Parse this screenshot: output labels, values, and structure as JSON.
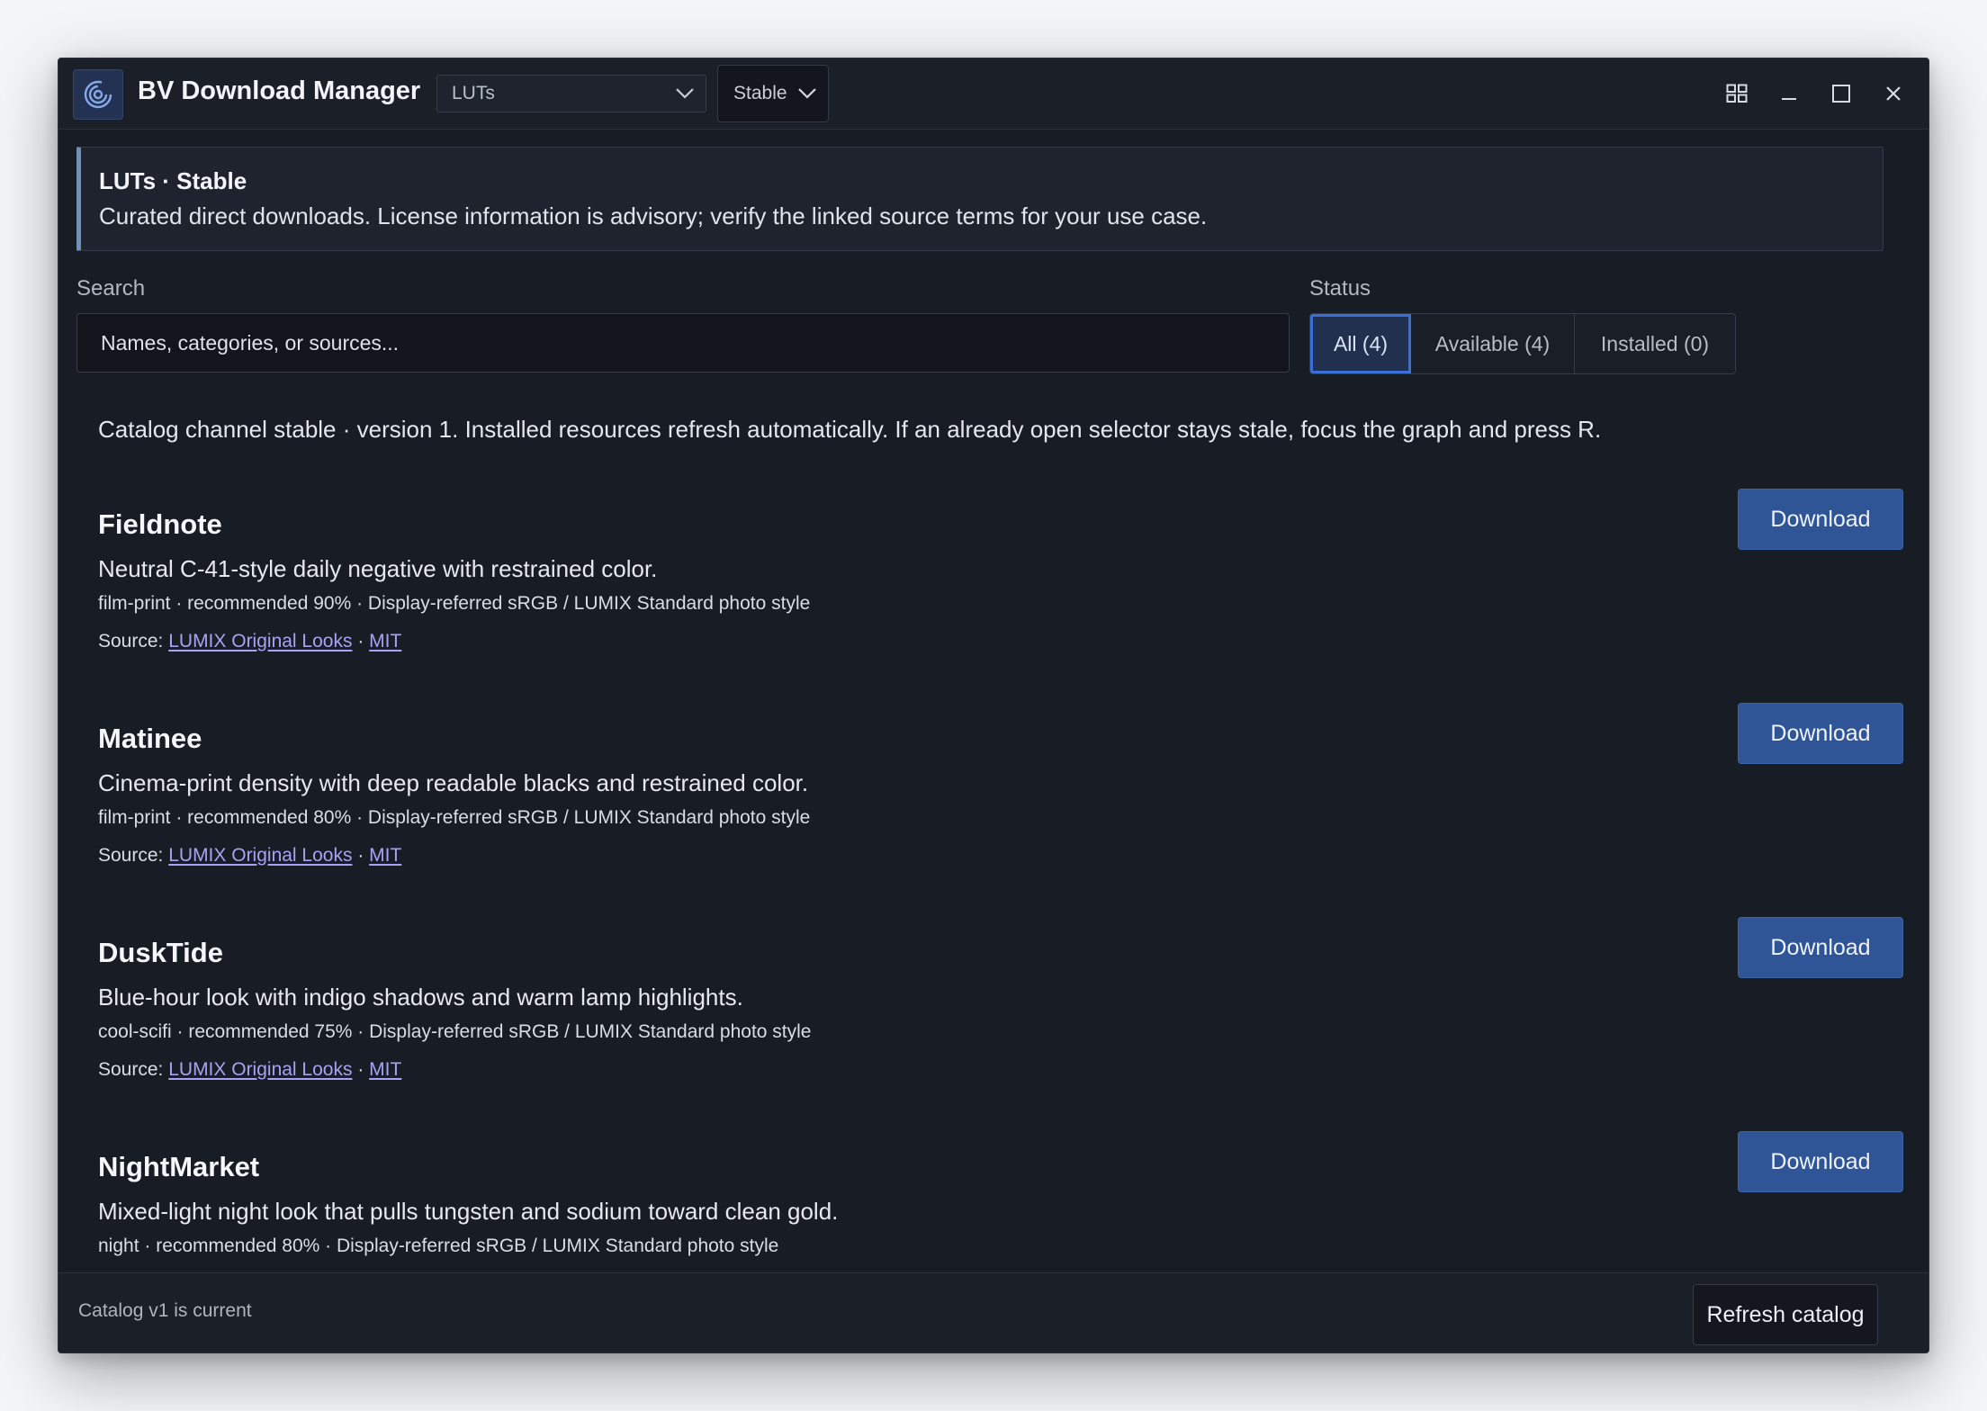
{
  "app": {
    "title": "BV Download Manager",
    "icon": "swirl-icon",
    "accent_color": "#3b6fd8"
  },
  "header": {
    "category_select": {
      "value": "LUTs"
    },
    "channel_select": {
      "value": "Stable"
    },
    "controls": [
      "grid-icon",
      "minimize-icon",
      "maximize-icon",
      "close-icon"
    ]
  },
  "banner": {
    "title": "LUTs · Stable",
    "text": "Curated direct downloads. License information is advisory; verify the linked source terms for your use case."
  },
  "search": {
    "label": "Search",
    "placeholder": "Names, categories, or sources...",
    "value": ""
  },
  "status_filter": {
    "label": "Status",
    "options": [
      "All (4)",
      "Available (4)",
      "Installed (0)"
    ],
    "selected": "All (4)"
  },
  "catalog_note": "Catalog channel stable · version 1. Installed resources refresh automatically. If an already open selector stays stale, focus the graph and press R.",
  "items": [
    {
      "name": "Fieldnote",
      "description": "Neutral C-41-style daily negative with restrained color.",
      "meta": "film-print · recommended 90% · Display-referred sRGB / LUMIX Standard photo style",
      "source_prefix": "Source:",
      "source_link": "LUMIX Original Looks",
      "separator": "·",
      "license_link": "MIT",
      "action": "Download"
    },
    {
      "name": "Matinee",
      "description": "Cinema-print density with deep readable blacks and restrained color.",
      "meta": "film-print · recommended 80% · Display-referred sRGB / LUMIX Standard photo style",
      "source_prefix": "Source:",
      "source_link": "LUMIX Original Looks",
      "separator": "·",
      "license_link": "MIT",
      "action": "Download"
    },
    {
      "name": "DuskTide",
      "description": "Blue-hour look with indigo shadows and warm lamp highlights.",
      "meta": "cool-scifi · recommended 75% · Display-referred sRGB / LUMIX Standard photo style",
      "source_prefix": "Source:",
      "source_link": "LUMIX Original Looks",
      "separator": "·",
      "license_link": "MIT",
      "action": "Download"
    },
    {
      "name": "NightMarket",
      "description": "Mixed-light night look that pulls tungsten and sodium toward clean gold.",
      "meta": "night · recommended 80% · Display-referred sRGB / LUMIX Standard photo style",
      "action": "Download"
    }
  ],
  "footer": {
    "status": "Catalog v1 is current",
    "refresh_label": "Refresh catalog"
  }
}
